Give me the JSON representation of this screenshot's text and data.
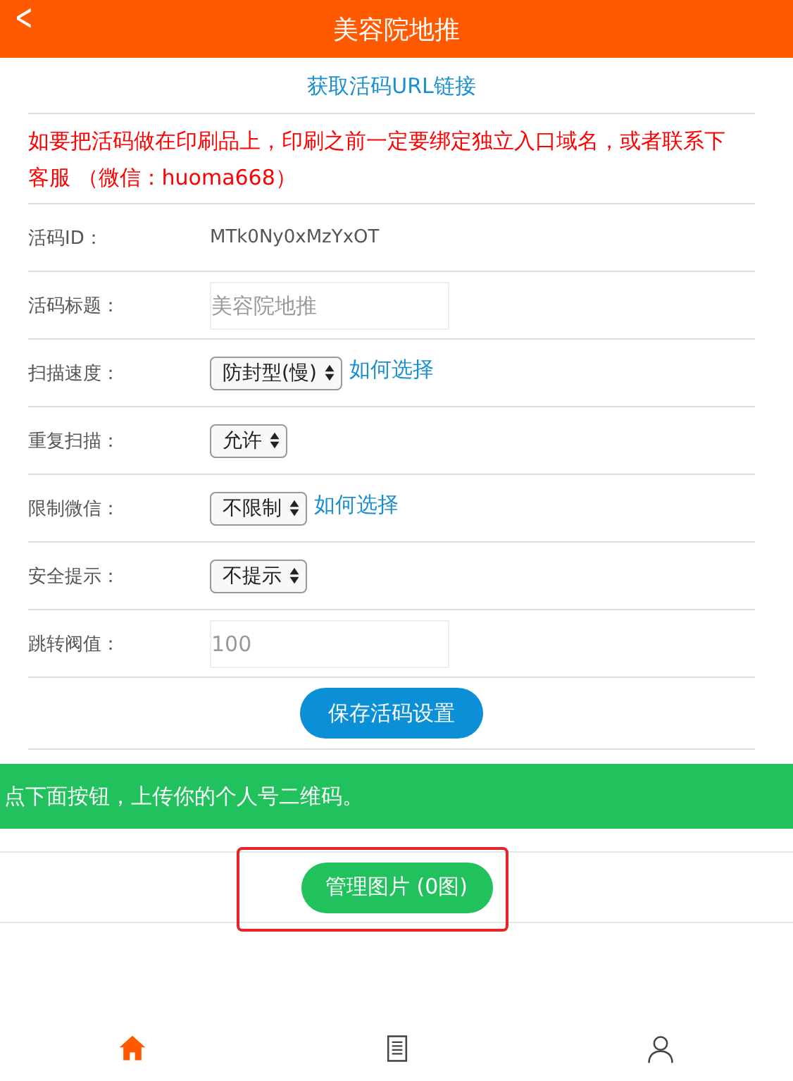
{
  "header": {
    "title": "美容院地推",
    "back": "<"
  },
  "url_link": "获取活码URL链接",
  "notice": "如要把活码做在印刷品上，印刷之前一定要绑定独立入口域名，或者联系下客服 （微信：huoma668）",
  "fields": [
    {
      "kind": "text",
      "label": "活码ID：",
      "value": "MTk0Ny0xMzYxOT"
    },
    {
      "kind": "input",
      "label": "活码标题：",
      "placeholder": "美容院地推"
    },
    {
      "kind": "select",
      "label": "扫描速度：",
      "value": "防封型(慢)",
      "help": "如何选择"
    },
    {
      "kind": "select",
      "label": "重复扫描：",
      "value": "允许"
    },
    {
      "kind": "select",
      "label": "限制微信：",
      "value": "不限制",
      "help": "如何选择"
    },
    {
      "kind": "select",
      "label": "安全提示：",
      "value": "不提示"
    },
    {
      "kind": "input",
      "label": "跳转阀值：",
      "placeholder": "100"
    }
  ],
  "save_button": "保存活码设置",
  "banner": "点下面按钮，上传你的个人号二维码。",
  "manage_button": {
    "label": "管理图片 (0图)",
    "highlighted": true
  },
  "tabbar": [
    {
      "kind": "home",
      "selected": true
    },
    {
      "kind": "document",
      "selected": false
    },
    {
      "kind": "person",
      "selected": false
    }
  ]
}
